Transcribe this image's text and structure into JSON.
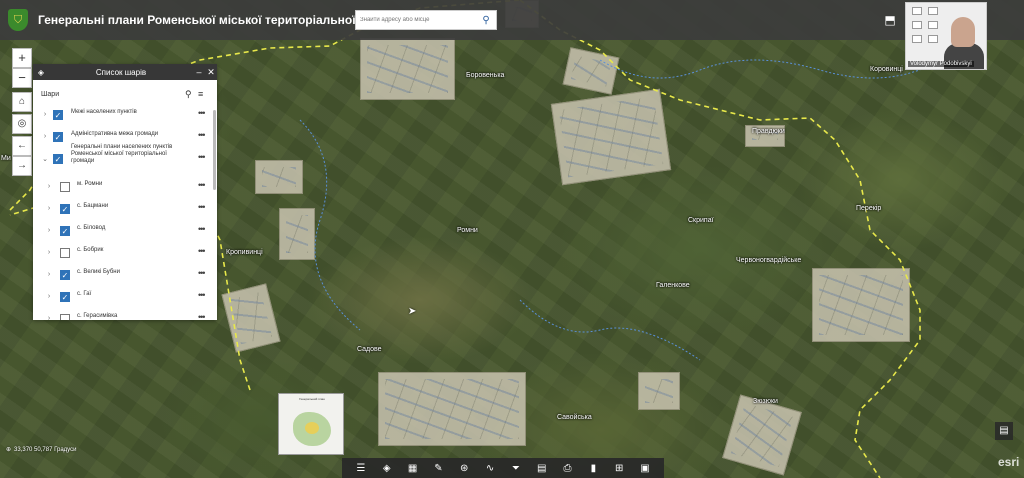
{
  "header": {
    "title": "Генеральні плани Роменської міської територіальної громади",
    "search_placeholder": "Знайти адресу або місце"
  },
  "icons": {
    "search": "⚲",
    "layers": "◈",
    "minimize": "–",
    "close": "✕",
    "filter": "≡",
    "more": "•••",
    "expand": "›",
    "collapse": "⌄",
    "check": "✓"
  },
  "map_controls": {
    "zoom_in": "+",
    "zoom_out": "−",
    "home": "⌂",
    "locate": "◎",
    "back": "←",
    "forward": "→"
  },
  "layer_panel": {
    "title": "Список шарів",
    "heading": "Шари",
    "layers": [
      {
        "label": "Межі населених пунктів",
        "checked": true,
        "arrow": "›"
      },
      {
        "label": "Адміністративна межа громади",
        "checked": true,
        "arrow": "›"
      },
      {
        "label": "Генеральні плани населених пунктів Роменської міської територіальної громади",
        "checked": true,
        "arrow": "⌄"
      },
      {
        "label": "м. Ромни",
        "checked": false,
        "arrow": "›"
      },
      {
        "label": "с. Бацмани",
        "checked": true,
        "arrow": "›"
      },
      {
        "label": "с. Біловод",
        "checked": true,
        "arrow": "›"
      },
      {
        "label": "с. Бобрик",
        "checked": false,
        "arrow": "›"
      },
      {
        "label": "с. Великі Бубни",
        "checked": true,
        "arrow": "›"
      },
      {
        "label": "с. Гаї",
        "checked": true,
        "arrow": "›"
      },
      {
        "label": "с. Герасимівка",
        "checked": false,
        "arrow": "›"
      }
    ]
  },
  "map_labels": [
    {
      "name": "Боровенька"
    },
    {
      "name": "Правдюки"
    },
    {
      "name": "Коровинці"
    },
    {
      "name": "Скрипаї"
    },
    {
      "name": "Перекір"
    },
    {
      "name": "Червоногвардійське"
    },
    {
      "name": "Галенкове"
    },
    {
      "name": "Ромни"
    },
    {
      "name": "Кропивинці"
    },
    {
      "name": "Садове"
    },
    {
      "name": "Савойська"
    },
    {
      "name": "Зюзюки"
    },
    {
      "name": "Ми"
    }
  ],
  "video": {
    "name": "Volodymyr Podobivskyi"
  },
  "coordinates": "33,370 50,787 Градуси",
  "toolbar_icons": [
    "☰",
    "◈",
    "▦",
    "✎",
    "⊛",
    "∿",
    "⏷",
    "▤",
    "⎙",
    "▮",
    "⊞",
    "▣"
  ],
  "legend_icon": "▤",
  "esri": "esri",
  "inset_title": "Генеральний план"
}
